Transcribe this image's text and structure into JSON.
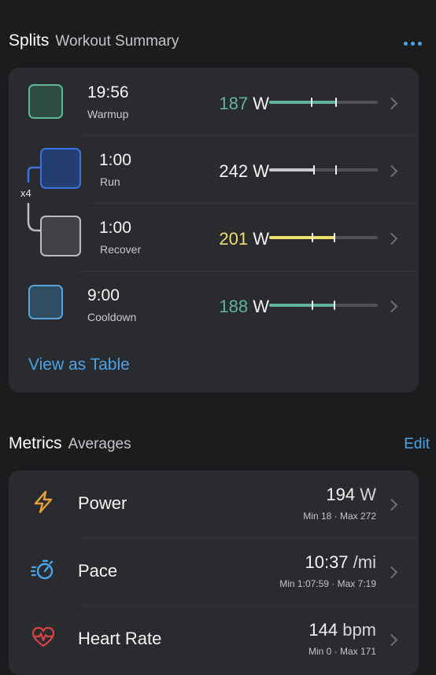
{
  "splits": {
    "title": "Splits",
    "subtitle": "Workout Summary",
    "repeat_label": "x4",
    "view_table_label": "View as Table",
    "items": [
      {
        "time": "19:56",
        "name": "Warmup",
        "watts": "187",
        "unit": "W",
        "color": "#5fb59a",
        "box_fill": "#2f4d43",
        "fill_fraction": 0.62
      },
      {
        "time": "1:00",
        "name": "Run",
        "watts": "242",
        "unit": "W",
        "color": "#f5f5f5",
        "box_border": "#3c72e0",
        "box_fill": "#233e70",
        "bar_color": "#c8c9cc",
        "fill_fraction": 0.42
      },
      {
        "time": "1:00",
        "name": "Recover",
        "watts": "201",
        "unit": "W",
        "color": "#f0df6c",
        "box_border": "#bdbec2",
        "box_fill": "#414246",
        "bar_color": "#f0df6c",
        "fill_fraction": 0.6
      },
      {
        "time": "9:00",
        "name": "Cooldown",
        "watts": "188",
        "unit": "W",
        "color": "#5fb59a",
        "box_border": "#5ba4dc",
        "box_fill": "#2f4e63",
        "bar_color": "#5fb59a",
        "fill_fraction": 0.6
      }
    ]
  },
  "metrics": {
    "title": "Metrics",
    "subtitle": "Averages",
    "edit_label": "Edit",
    "items": [
      {
        "label": "Power",
        "value": "194",
        "unit": "W",
        "minmax": "Min 18 · Max 272",
        "icon": "lightning-icon",
        "icon_color": "#e8a23a"
      },
      {
        "label": "Pace",
        "value": "10:37",
        "unit": "/mi",
        "minmax": "Min 1:07:59 · Max 7:19",
        "icon": "stopwatch-icon",
        "icon_color": "#4aa3e8"
      },
      {
        "label": "Heart Rate",
        "value": "144",
        "unit": "bpm",
        "minmax": "Min 0 · Max 171",
        "icon": "heart-rate-icon",
        "icon_color": "#d9434a"
      }
    ]
  }
}
